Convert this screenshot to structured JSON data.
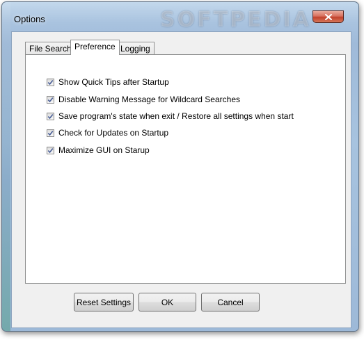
{
  "window": {
    "title": "Options",
    "watermark": "SOFTPEDIA"
  },
  "tabs": [
    {
      "label": "File Search",
      "active": false
    },
    {
      "label": "Preference",
      "active": true
    },
    {
      "label": "Logging",
      "active": false
    }
  ],
  "options": [
    {
      "label": "Show Quick Tips after Startup",
      "checked": true
    },
    {
      "label": "Disable Warning Message for Wildcard Searches",
      "checked": true
    },
    {
      "label": "Save program's state when exit / Restore all settings when start",
      "checked": true
    },
    {
      "label": "Check for Updates on Startup",
      "checked": true
    },
    {
      "label": "Maximize GUI on Starup",
      "checked": true
    }
  ],
  "buttons": {
    "reset": "Reset Settings",
    "ok": "OK",
    "cancel": "Cancel"
  }
}
